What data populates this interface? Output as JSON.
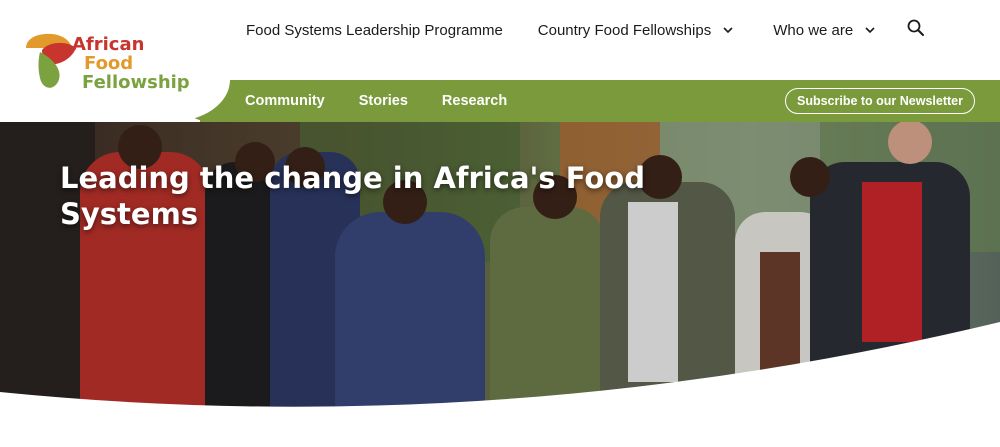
{
  "logo": {
    "line1": "African",
    "line2": "Food",
    "line3": "Fellowship"
  },
  "main_nav": {
    "items": [
      {
        "label": "Food Systems Leadership Programme",
        "has_dropdown": false
      },
      {
        "label": "Country Food Fellowships",
        "has_dropdown": true
      },
      {
        "label": "Who we are",
        "has_dropdown": true
      }
    ],
    "search_icon": "search-icon"
  },
  "sub_nav": {
    "links": [
      "Community",
      "Stories",
      "Research"
    ],
    "newsletter_label": "Subscribe to our Newsletter"
  },
  "hero": {
    "title": "Leading the change in Africa's Food Systems"
  },
  "colors": {
    "brand_red": "#c8352f",
    "brand_orange": "#e39a2d",
    "brand_green": "#7ba23e",
    "sub_bar": "#7a9a3b"
  }
}
